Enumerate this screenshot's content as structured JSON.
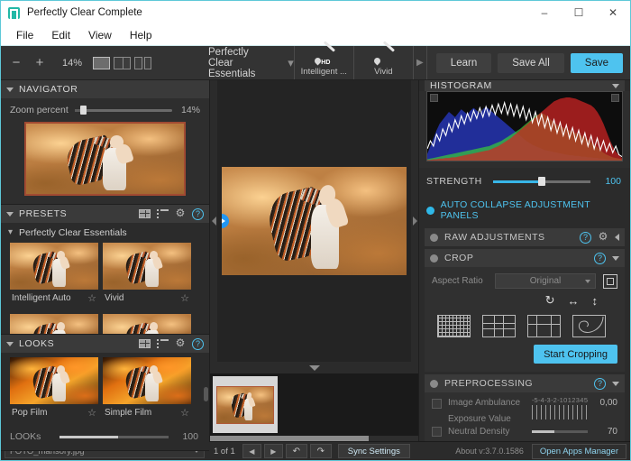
{
  "window": {
    "title": "Perfectly Clear Complete",
    "logo_icon": "app-logo-icon",
    "minimize": "–",
    "maximize": "☐",
    "close": "✕"
  },
  "menu": {
    "items": [
      "File",
      "Edit",
      "View",
      "Help"
    ]
  },
  "toolbar": {
    "zoom_out_icon": "minus-icon",
    "zoom_in_icon": "plus-icon",
    "zoom_value": "14%",
    "view_modes": [
      "single-view-icon",
      "split-view-icon",
      "dual-view-icon"
    ],
    "preset_label": "Perfectly Clear Essentials",
    "preset_chevron_icon": "chevron-down-icon",
    "thumbs": [
      {
        "caption": "Intelligent ...",
        "icon": "brush-hd-icon",
        "badge": "HD"
      },
      {
        "caption": "Vivid",
        "icon": "brush-icon",
        "badge": ""
      }
    ],
    "scroll_right_icon": "chevron-right-icon",
    "learn_label": "Learn",
    "save_all_label": "Save All",
    "save_label": "Save",
    "accent": "#4ec3ef"
  },
  "left_panel": {
    "navigator": {
      "title": "NAVIGATOR",
      "collapse_icon": "triangle-down-icon",
      "zoom_label": "Zoom percent",
      "zoom_value": "14%"
    },
    "presets": {
      "title": "PRESETS",
      "collapse_icon": "triangle-down-icon",
      "icons": [
        "grid-view-icon",
        "list-view-icon",
        "gear-icon",
        "help-icon"
      ],
      "group_label": "Perfectly Clear Essentials",
      "group_chevron_icon": "chevron-down-icon",
      "items": [
        {
          "label": "Intelligent Auto",
          "star_icon": "star-outline-icon"
        },
        {
          "label": "Vivid",
          "star_icon": "star-outline-icon"
        }
      ]
    },
    "looks": {
      "title": "LOOKS",
      "collapse_icon": "triangle-down-icon",
      "icons": [
        "grid-view-icon",
        "list-view-icon",
        "gear-icon",
        "help-icon"
      ],
      "items": [
        {
          "label": "Pop Film",
          "star_icon": "star-outline-icon"
        },
        {
          "label": "Simple Film",
          "star_icon": "star-outline-icon"
        }
      ],
      "slider_label": "LOOKs",
      "slider_value": "100"
    }
  },
  "center": {
    "compare_play_icon": "play-circle-icon",
    "collapse_left_icon": "triangle-left-icon",
    "collapse_right_icon": "triangle-right-icon",
    "filmstrip_toggle_icon": "triangle-down-icon"
  },
  "right_panel": {
    "histogram": {
      "title": "HISTOGRAM",
      "collapse_icon": "triangle-down-icon"
    },
    "strength": {
      "label": "STRENGTH",
      "value": "100"
    },
    "auto_collapse": {
      "label": "AUTO COLLAPSE ADJUSTMENT PANELS",
      "toggle_icon": "radio-on-icon"
    },
    "sections": [
      {
        "title": "RAW ADJUSTMENTS",
        "dot_icon": "status-dot-icon",
        "help_icon": "help-icon",
        "gear_icon": "gear-icon",
        "expand_icon": "triangle-left-icon"
      },
      {
        "title": "CROP",
        "dot_icon": "status-dot-icon",
        "help_icon": "help-icon",
        "expand_icon": "triangle-down-icon"
      }
    ],
    "crop": {
      "aspect_label": "Aspect Ratio",
      "aspect_value": "Original",
      "crop_tool_icon": "crop-icon",
      "rotate_icon": "rotate-icon",
      "flip_h_icon": "flip-horizontal-icon",
      "flip_v_icon": "flip-vertical-icon",
      "overlays": [
        "grid-fine-icon",
        "grid-thirds-icon",
        "grid-quad-icon",
        "golden-spiral-icon"
      ],
      "start_button": "Start Cropping"
    },
    "preprocessing": {
      "title": "PREPROCESSING",
      "dot_icon": "status-dot-icon",
      "help_icon": "help-icon",
      "collapse_icon": "triangle-down-icon",
      "rows": [
        {
          "label": "Image Ambulance",
          "sub_label": "Exposure Value",
          "scale": [
            "-5",
            "-4",
            "-3",
            "-2",
            "-1",
            "0",
            "1",
            "2",
            "3",
            "4",
            "5"
          ],
          "value": "0,00",
          "checkbox_icon": "checkbox-icon"
        },
        {
          "label": "Neutral Density",
          "value": "70",
          "checkbox_icon": "checkbox-icon"
        }
      ]
    }
  },
  "status_bar": {
    "filename": "FOTO_mansory.jpg",
    "file_dropdown_icon": "chevron-down-icon",
    "page_count": "1 of 1",
    "prev_icon": "◀",
    "next_icon": "▶",
    "undo_icon": "↶",
    "redo_icon": "↷",
    "sync_label": "Sync Settings",
    "about": "About v:3.7.0.1586",
    "apps_manager": "Open Apps Manager"
  },
  "chart_data": {
    "type": "area",
    "title": "HISTOGRAM",
    "channels": [
      "red",
      "green",
      "blue",
      "luminance"
    ],
    "bins": 64,
    "series": [
      {
        "name": "blue",
        "color": "#2a3bd0",
        "values": [
          10,
          22,
          34,
          46,
          56,
          62,
          68,
          74,
          70,
          66,
          72,
          78,
          74,
          70,
          76,
          80,
          76,
          72,
          78,
          82,
          78,
          74,
          70,
          66,
          62,
          58,
          54,
          50,
          46,
          42,
          38,
          34,
          30,
          27,
          24,
          22,
          20,
          18,
          16,
          15,
          14,
          13,
          12,
          11,
          10,
          9,
          8,
          8,
          7,
          7,
          6,
          6,
          5,
          5,
          4,
          4,
          3,
          3,
          2,
          2,
          2,
          1,
          1,
          1
        ]
      },
      {
        "name": "green",
        "color": "#38c93a",
        "values": [
          2,
          3,
          4,
          5,
          6,
          7,
          8,
          9,
          10,
          11,
          12,
          13,
          14,
          15,
          16,
          17,
          18,
          19,
          20,
          21,
          22,
          24,
          26,
          28,
          30,
          33,
          36,
          39,
          42,
          45,
          48,
          52,
          56,
          60,
          64,
          68,
          70,
          72,
          70,
          66,
          62,
          58,
          54,
          52,
          50,
          48,
          46,
          44,
          42,
          40,
          38,
          35,
          32,
          28,
          24,
          20,
          16,
          12,
          9,
          7,
          5,
          4,
          3,
          2
        ]
      },
      {
        "name": "red",
        "color": "#d22424",
        "values": [
          1,
          1,
          2,
          2,
          3,
          3,
          4,
          4,
          5,
          5,
          6,
          7,
          8,
          9,
          10,
          11,
          12,
          13,
          14,
          15,
          16,
          18,
          20,
          22,
          25,
          28,
          31,
          34,
          38,
          42,
          46,
          50,
          54,
          58,
          62,
          66,
          70,
          74,
          78,
          82,
          86,
          90,
          92,
          94,
          95,
          96,
          96,
          95,
          94,
          92,
          90,
          88,
          86,
          84,
          80,
          74,
          66,
          56,
          44,
          32,
          22,
          14,
          8,
          4
        ]
      },
      {
        "name": "luminance",
        "color": "#ffffff",
        "values": [
          18,
          30,
          22,
          40,
          30,
          48,
          38,
          56,
          44,
          62,
          50,
          68,
          56,
          72,
          60,
          76,
          64,
          80,
          66,
          82,
          68,
          84,
          70,
          86,
          72,
          88,
          70,
          86,
          68,
          84,
          66,
          82,
          62,
          78,
          58,
          74,
          54,
          70,
          50,
          66,
          46,
          62,
          42,
          58,
          38,
          54,
          34,
          50,
          30,
          46,
          26,
          42,
          22,
          38,
          18,
          34,
          16,
          30,
          14,
          26,
          12,
          22,
          9,
          6
        ]
      }
    ],
    "xlabel": "",
    "ylabel": "",
    "grid": false,
    "legend": "none"
  }
}
